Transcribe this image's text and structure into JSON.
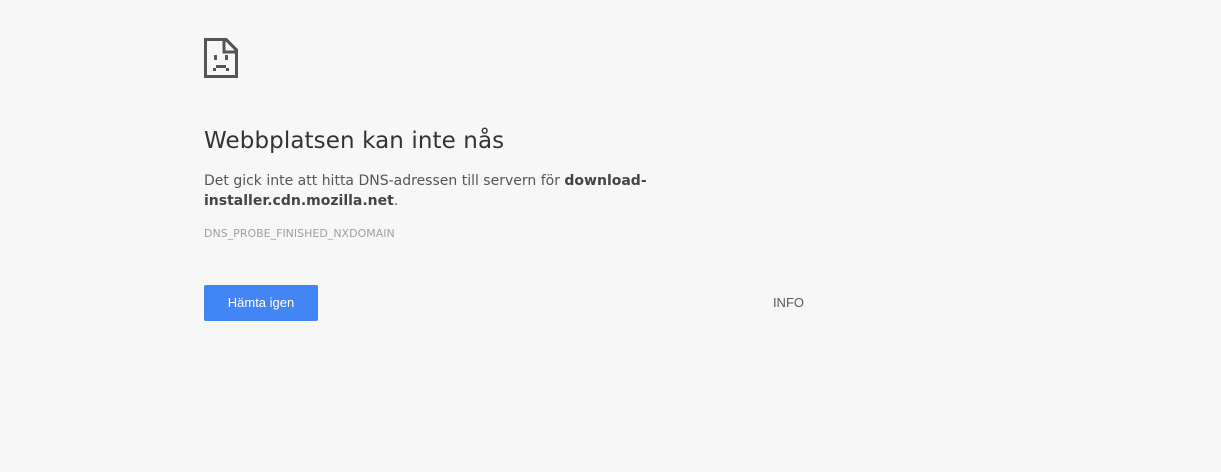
{
  "error": {
    "icon": "sad-document-icon",
    "title": "Webbplatsen kan inte nås",
    "message_prefix": "Det gick inte att hitta DNS-adressen till servern för ",
    "domain": "download-installer.cdn.mozilla.net",
    "message_suffix": ".",
    "code": "DNS_PROBE_FINISHED_NXDOMAIN"
  },
  "actions": {
    "reload_label": "Hämta igen",
    "details_label": "INFO"
  },
  "colors": {
    "background": "#f7f7f7",
    "button_blue": "#4285f4",
    "text": "#333333"
  }
}
